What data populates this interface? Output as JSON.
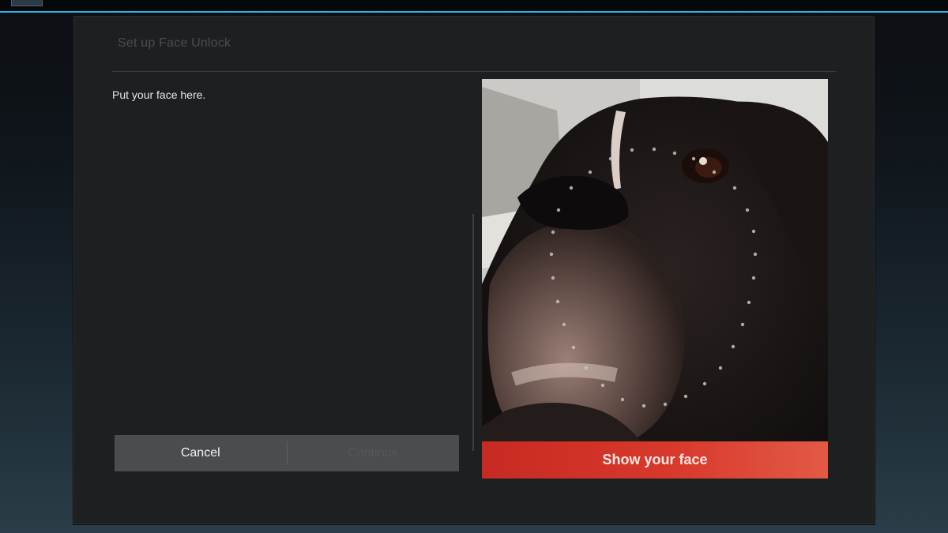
{
  "dialog": {
    "title": "Set up Face Unlock",
    "instruction": "Put your face here."
  },
  "buttons": {
    "cancel_label": "Cancel",
    "continue_label": "Continue"
  },
  "camera": {
    "status_text": "Show your face",
    "banner_color": "#d8392c"
  },
  "theme": {
    "accent": "#33b5e5",
    "dialog_background": "#1e1f21"
  }
}
